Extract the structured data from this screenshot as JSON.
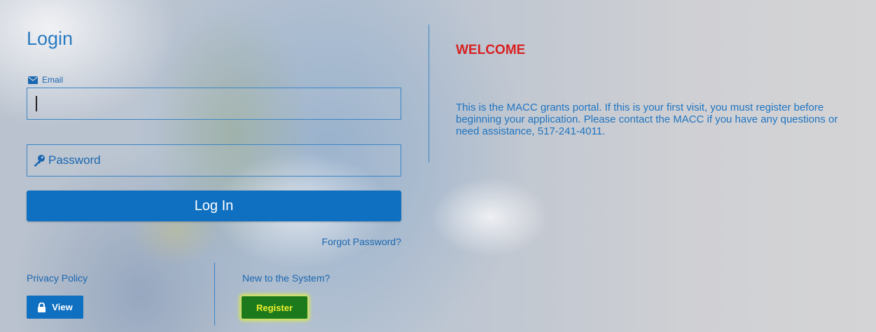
{
  "login": {
    "title": "Login",
    "email_label": "Email",
    "email_value": "",
    "password_placeholder": "Password",
    "login_button": "Log In",
    "forgot_password": "Forgot Password?"
  },
  "footer": {
    "privacy_label": "Privacy Policy",
    "view_button": "View",
    "new_system_label": "New to the System?",
    "register_button": "Register"
  },
  "welcome": {
    "title": "WELCOME",
    "message": "This is the MACC grants portal. If this is your first visit, you must register before beginning your application. Please contact the MACC if you have any questions or need assistance, 517-241-4011."
  },
  "colors": {
    "primary_blue": "#0f6fc0",
    "welcome_red": "#d82020",
    "register_green": "#1c7a1c",
    "highlight_yellow": "#f0f030"
  },
  "icons": {
    "email": "envelope-icon",
    "password": "key-icon",
    "view": "lock-icon"
  }
}
